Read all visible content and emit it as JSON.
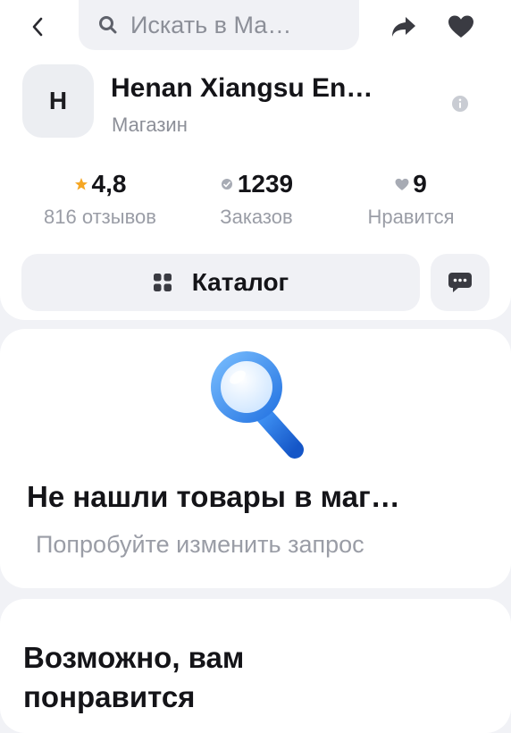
{
  "header": {
    "back_icon": "chevron-left-icon",
    "search_placeholder": "Искать в Ма…",
    "share_icon": "share-arrow-icon",
    "favorite_icon": "heart-icon"
  },
  "shop": {
    "avatar_letter": "H",
    "name": "Henan Xiangsu En…",
    "type": "Магазин"
  },
  "stats": [
    {
      "value": "4,8",
      "label": "816 отзывов",
      "icon": "star-icon",
      "color": "#f5a623"
    },
    {
      "value": "1239",
      "label": "Заказов",
      "icon": "order-icon",
      "color": "#a7abb4"
    },
    {
      "value": "9",
      "label": "Нравится",
      "icon": "heart-icon",
      "color": "#a7abb4"
    }
  ],
  "catalog": {
    "label": "Каталог",
    "icon": "grid-icon"
  },
  "chat_icon": "chat-icon",
  "empty_state": {
    "icon": "magnifier-icon",
    "title": "Не нашли товары в маг…",
    "subtitle": "Попробуйте изменить запрос"
  },
  "recommendations": {
    "title": "Возможно, вам понравится"
  },
  "colors": {
    "accent_blue": "#2f8df5",
    "star": "#f5a623",
    "text_secondary": "#9a9da6",
    "surface": "#f0f1f5"
  }
}
